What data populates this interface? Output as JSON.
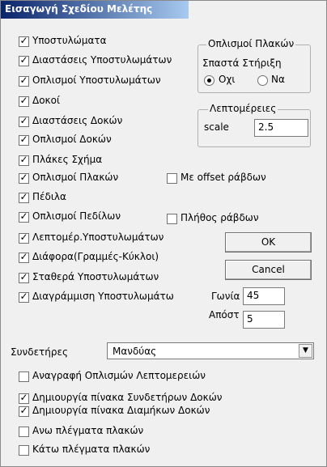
{
  "window": {
    "title": "Εισαγωγή Σχεδίου Μελέτης"
  },
  "options": [
    {
      "label": "Υποστυλώματα",
      "checked": true
    },
    {
      "label": "Διαστάσεις Υποστυλωμάτων",
      "checked": true
    },
    {
      "label": "Οπλισμοί Υποστυλωμάτων",
      "checked": true
    },
    {
      "label": "Δοκοί",
      "checked": true
    },
    {
      "label": "Διαστάσεις Δοκών",
      "checked": true
    },
    {
      "label": "Οπλισμοί Δοκών",
      "checked": true
    },
    {
      "label": "Πλάκες Σχήμα",
      "checked": true
    },
    {
      "label": "Οπλισμοί Πλακών",
      "checked": true
    },
    {
      "label": "Πέδιλα",
      "checked": true
    },
    {
      "label": "Οπλισμοί Πεδίλων",
      "checked": true
    },
    {
      "label": "Λεπτομέρ.Υποστυλωμάτων",
      "checked": true
    },
    {
      "label": "Διάφορα(Γραμμές-Κύκλοι)",
      "checked": true
    },
    {
      "label": "Σταθερά Υποστυλωμάτων",
      "checked": true
    },
    {
      "label": "Διαγράμμιση Υποστυλωμάτω",
      "checked": true
    }
  ],
  "offset_option": {
    "label": "Με offset ράβδων",
    "checked": false
  },
  "count_option": {
    "label": "Πλήθος ράβδων",
    "checked": false
  },
  "slab_group": {
    "title": "Οπλισμοί Πλακών",
    "subtitle": "Σπαστά Στήριξη",
    "radio_no": {
      "label": "Οχι",
      "selected": true
    },
    "radio_yes": {
      "label": "Να",
      "selected": false
    }
  },
  "details_group": {
    "title": "Λεπτομέρειες",
    "scale_label": "scale",
    "scale_value": "2.5"
  },
  "buttons": {
    "ok": "OK",
    "cancel": "Cancel"
  },
  "hatch": {
    "angle_label": "Γωνία",
    "angle_value": "45",
    "spacing_label": "Απόστ",
    "spacing_value": "5"
  },
  "stirrups": {
    "label": "Συνδετήρες",
    "value": "Μανδύας"
  },
  "bottom_options": [
    {
      "label": "Αναγραφή Οπλισμών Λεπτομερειών",
      "checked": false
    },
    {
      "label": "Δημιουργία πίνακα Συνδετήρων Δοκών",
      "checked": true
    },
    {
      "label": "Δημιουργία πίνακα Διαμήκων Δοκών",
      "checked": true
    },
    {
      "label": "Ανω πλέγματα πλακών",
      "checked": false
    },
    {
      "label": "Κάτω πλέγματα πλακών",
      "checked": false
    }
  ]
}
